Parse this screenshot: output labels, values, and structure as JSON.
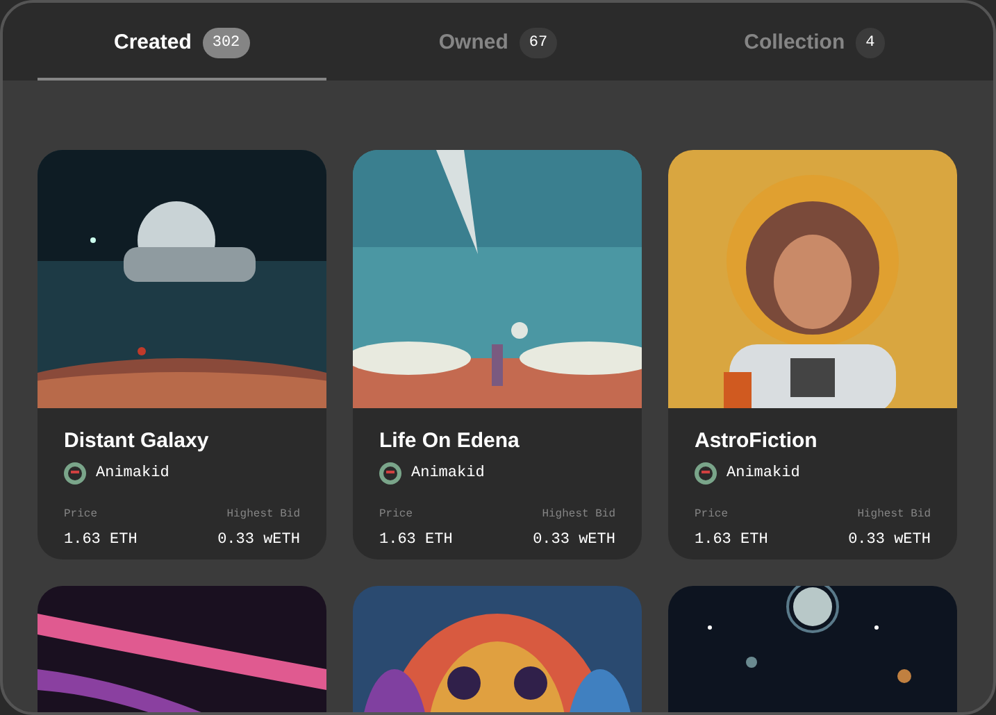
{
  "tabs": [
    {
      "label": "Created",
      "count": "302",
      "selected": true
    },
    {
      "label": "Owned",
      "count": "67",
      "selected": false
    },
    {
      "label": "Collection",
      "count": "4",
      "selected": false
    }
  ],
  "cards": [
    {
      "title": "Distant Galaxy",
      "author": "Animakid",
      "price_label": "Price",
      "price": "1.63 ETH",
      "bid_label": "Highest Bid",
      "bid": "0.33 wETH"
    },
    {
      "title": "Life On Edena",
      "author": "Animakid",
      "price_label": "Price",
      "price": "1.63 ETH",
      "bid_label": "Highest Bid",
      "bid": "0.33 wETH"
    },
    {
      "title": "AstroFiction",
      "author": "Animakid",
      "price_label": "Price",
      "price": "1.63 ETH",
      "bid_label": "Highest Bid",
      "bid": "0.33 wETH"
    }
  ]
}
